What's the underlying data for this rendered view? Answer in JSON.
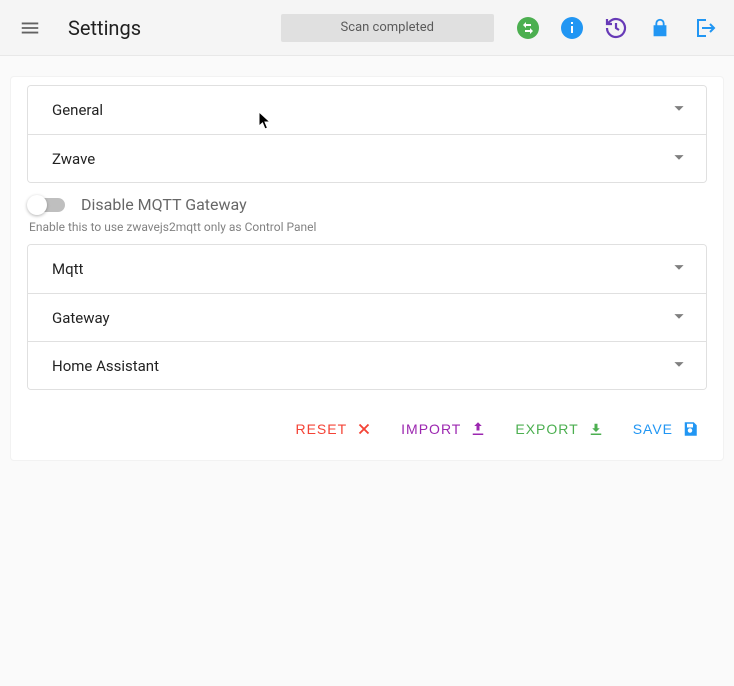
{
  "header": {
    "title": "Settings",
    "status": "Scan completed"
  },
  "sections": {
    "group1": [
      {
        "label": "General"
      },
      {
        "label": "Zwave"
      }
    ],
    "toggle": {
      "label": "Disable MQTT Gateway",
      "hint": "Enable this to use zwavejs2mqtt only as Control Panel",
      "value": false
    },
    "group2": [
      {
        "label": "Mqtt"
      },
      {
        "label": "Gateway"
      },
      {
        "label": "Home Assistant"
      }
    ]
  },
  "actions": {
    "reset": "RESET",
    "import": "IMPORT",
    "export": "EXPORT",
    "save": "SAVE"
  },
  "colors": {
    "green": "#4caf50",
    "blue": "#2196f3",
    "purple": "#673ab7",
    "red": "#f44336",
    "violet": "#9c27b0"
  }
}
